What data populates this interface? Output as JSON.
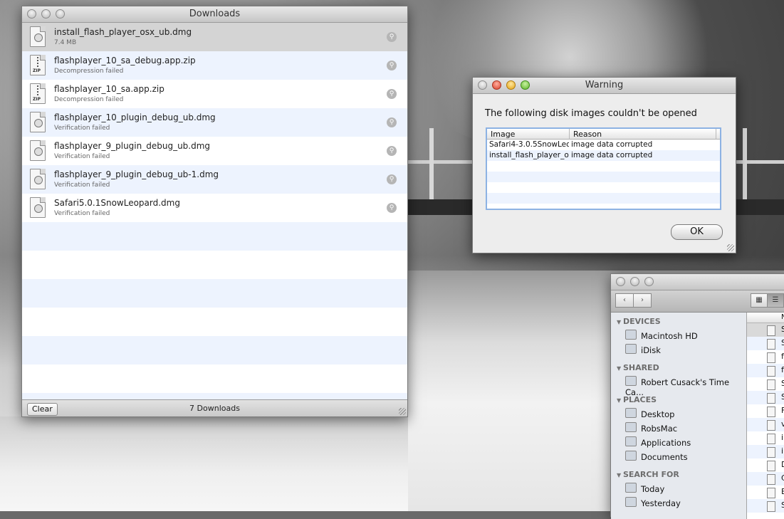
{
  "downloads": {
    "title": "Downloads",
    "items": [
      {
        "name": "install_flash_player_osx_ub.dmg",
        "status": "7.4 MB",
        "type": "dmg"
      },
      {
        "name": "flashplayer_10_sa_debug.app.zip",
        "status": "Decompression failed",
        "type": "zip"
      },
      {
        "name": "flashplayer_10_sa.app.zip",
        "status": "Decompression failed",
        "type": "zip"
      },
      {
        "name": "flashplayer_10_plugin_debug_ub.dmg",
        "status": "Verification failed",
        "type": "dmg"
      },
      {
        "name": "flashplayer_9_plugin_debug_ub.dmg",
        "status": "Verification failed",
        "type": "dmg"
      },
      {
        "name": "flashplayer_9_plugin_debug_ub-1.dmg",
        "status": "Verification failed",
        "type": "dmg"
      },
      {
        "name": "Safari5.0.1SnowLeopard.dmg",
        "status": "Verification failed",
        "type": "dmg"
      }
    ],
    "zip_badge": "ZIP",
    "clear_label": "Clear",
    "count_label": "7 Downloads"
  },
  "warning": {
    "title": "Warning",
    "message": "The following disk images couldn't be opened",
    "columns": [
      "Image",
      "Reason"
    ],
    "rows": [
      [
        "Safari4-3.0.5SnowLeop",
        "image data corrupted"
      ],
      [
        "install_flash_player_os",
        "image data corrupted"
      ]
    ],
    "ok_label": "OK"
  },
  "finder": {
    "back_icon": "‹",
    "forward_icon": "›",
    "sections": [
      {
        "label": "DEVICES",
        "items": [
          "Macintosh HD",
          "iDisk"
        ]
      },
      {
        "label": "SHARED",
        "items": [
          "Robert Cusack's Time Ca..."
        ]
      },
      {
        "label": "PLACES",
        "items": [
          "Desktop",
          "RobsMac",
          "Applications",
          "Documents"
        ]
      },
      {
        "label": "SEARCH FOR",
        "items": [
          "Today",
          "Yesterday"
        ]
      }
    ],
    "column_header": "N",
    "file_initials": [
      "S",
      "S",
      "f",
      "f",
      "S",
      "S",
      "F",
      "v",
      "i",
      "i",
      "D",
      "C",
      "E",
      "S"
    ]
  }
}
